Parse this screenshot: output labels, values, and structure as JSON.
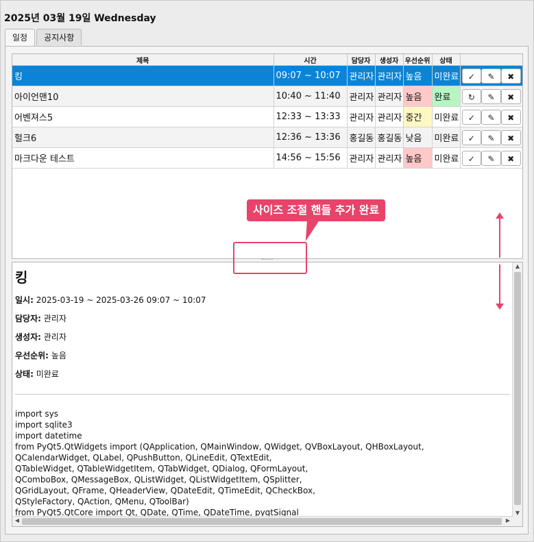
{
  "header": {
    "date": "2025년 03월 19일 Wednesday"
  },
  "tabs": [
    {
      "label": "일정"
    },
    {
      "label": "공지사항"
    }
  ],
  "table": {
    "headers": [
      "제목",
      "시간",
      "담당자",
      "생성자",
      "우선순위",
      "상태",
      ""
    ],
    "rows": [
      {
        "title": "킹",
        "time": "09:07 ~ 10:07",
        "assignee": "관리자",
        "creator": "관리자",
        "priority": "높음",
        "status": "미완료",
        "toggle_icon": "✓",
        "edit_icon": "✎",
        "delete_icon": "✖"
      },
      {
        "title": "아이언맨10",
        "time": "10:40 ~ 11:40",
        "assignee": "관리자",
        "creator": "관리자",
        "priority": "높음",
        "status": "완료",
        "toggle_icon": "↻",
        "edit_icon": "✎",
        "delete_icon": "✖"
      },
      {
        "title": "어벤져스5",
        "time": "12:33 ~ 13:33",
        "assignee": "관리자",
        "creator": "관리자",
        "priority": "중간",
        "status": "미완료",
        "toggle_icon": "✓",
        "edit_icon": "✎",
        "delete_icon": "✖"
      },
      {
        "title": "헐크6",
        "time": "12:36 ~ 13:36",
        "assignee": "홍길동",
        "creator": "홍길동",
        "priority": "낮음",
        "status": "미완료",
        "toggle_icon": "✓",
        "edit_icon": "✎",
        "delete_icon": "✖"
      },
      {
        "title": "마크다운 테스트",
        "time": "14:56 ~ 15:56",
        "assignee": "관리자",
        "creator": "관리자",
        "priority": "높음",
        "status": "미완료",
        "toggle_icon": "✓",
        "edit_icon": "✎",
        "delete_icon": "✖"
      }
    ]
  },
  "annotation": {
    "callout": "사이즈 조절 핸들 추가 완료"
  },
  "detail": {
    "title": "킹",
    "when_label": "일시:",
    "when_value": " 2025-03-19 ~ 2025-03-26 09:07 ~ 10:07",
    "assignee_label": "담당자:",
    "assignee_value": " 관리자",
    "creator_label": "생성자:",
    "creator_value": " 관리자",
    "priority_label": "우선순위:",
    "priority_value": " 높음",
    "status_label": "상태:",
    "status_value": " 미완료",
    "code": [
      "import sys",
      "import sqlite3",
      "import datetime",
      "from PyQt5.QtWidgets import (QApplication, QMainWindow, QWidget, QVBoxLayout, QHBoxLayout,",
      "QCalendarWidget, QLabel, QPushButton, QLineEdit, QTextEdit,",
      "QTableWidget, QTableWidgetItem, QTabWidget, QDialog, QFormLayout,",
      "QComboBox, QMessageBox, QListWidget, QListWidgetItem, QSplitter,",
      "QGridLayout, QFrame, QHeaderView, QDateEdit, QTimeEdit, QCheckBox,",
      "QStyleFactory, QAction, QMenu, QToolBar)",
      "from PyQt5.QtCore import Qt, QDate, QTime, QDateTime, pyqtSignal"
    ]
  },
  "colors": {
    "accent": "#e8436a",
    "selected_row": "#0a84d8",
    "priority_high": "#ffc9c9",
    "priority_mid": "#fff8c2",
    "status_done": "#b7f5c3"
  }
}
